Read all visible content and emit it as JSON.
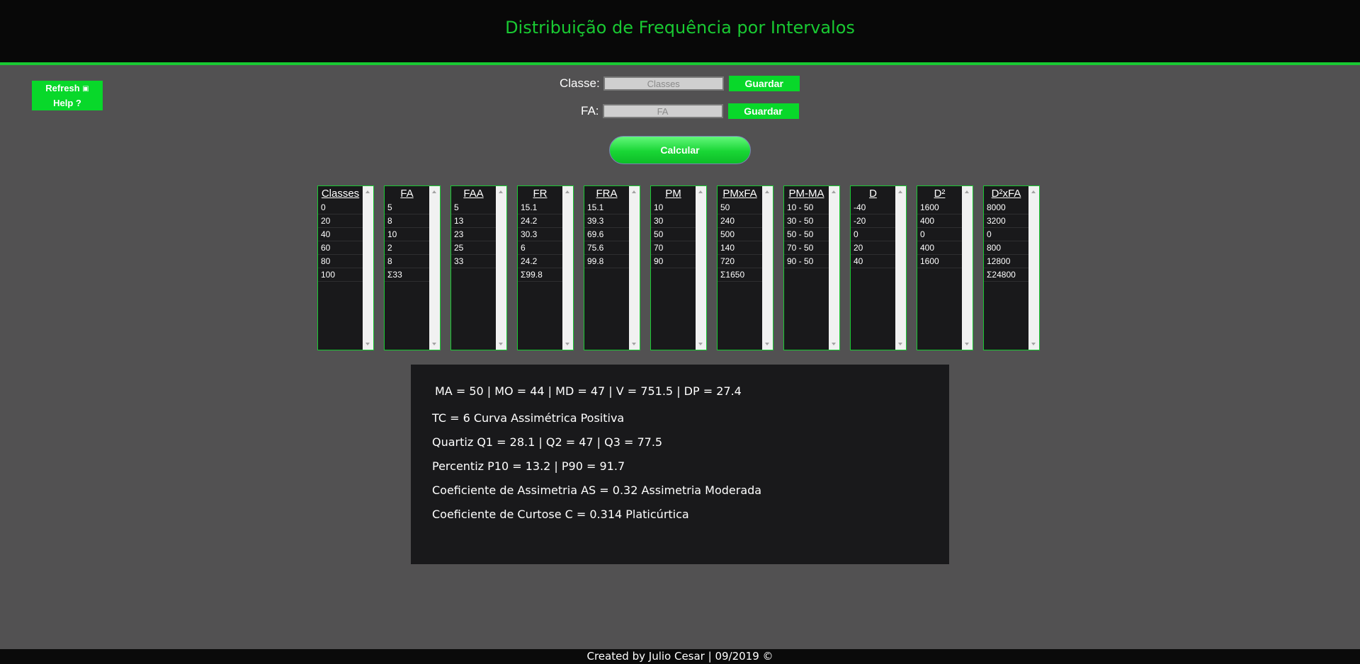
{
  "header": {
    "title": "Distribuição de Frequência por Intervalos"
  },
  "side": {
    "refresh_label": "Refresh",
    "help_label": "Help ?"
  },
  "form": {
    "classe_label": "Classe:",
    "classe_placeholder": "Classes",
    "fa_label": "FA:",
    "fa_placeholder": "FA",
    "save_label": "Guardar",
    "calc_label": "Calcular"
  },
  "columns": [
    {
      "title": "Classes",
      "values": [
        "0",
        "20",
        "40",
        "60",
        "80",
        "100"
      ]
    },
    {
      "title": "FA",
      "values": [
        "5",
        "8",
        "10",
        "2",
        "8",
        "Σ33"
      ]
    },
    {
      "title": "FAA",
      "values": [
        "5",
        "13",
        "23",
        "25",
        "33"
      ]
    },
    {
      "title": "FR",
      "values": [
        "15.1",
        "24.2",
        "30.3",
        "6",
        "24.2",
        "Σ99.8"
      ]
    },
    {
      "title": "FRA",
      "values": [
        "15.1",
        "39.3",
        "69.6",
        "75.6",
        "99.8"
      ]
    },
    {
      "title": "PM",
      "values": [
        "10",
        "30",
        "50",
        "70",
        "90"
      ]
    },
    {
      "title": "PMxFA",
      "values": [
        "50",
        "240",
        "500",
        "140",
        "720",
        "Σ1650"
      ]
    },
    {
      "title": "PM-MA",
      "values": [
        "10 - 50",
        "30 - 50",
        "50 - 50",
        "70 - 50",
        "90 - 50"
      ]
    },
    {
      "title": "D",
      "values": [
        "-40",
        "-20",
        "0",
        "20",
        "40"
      ]
    },
    {
      "title": "D²",
      "values": [
        "1600",
        "400",
        "0",
        "400",
        "1600"
      ]
    },
    {
      "title": "D²xFA",
      "values": [
        "8000",
        "3200",
        "0",
        "800",
        "12800",
        "Σ24800"
      ]
    }
  ],
  "results": {
    "line1": "MA = 50 | MO = 44 | MD = 47 | V = 751.5 | DP = 27.4",
    "line2": "TC = 6 Curva Assimétrica Positiva",
    "line3": "Quartiz Q1 = 28.1 | Q2 = 47 | Q3 = 77.5",
    "line4": "Percentiz P10 = 13.2 | P90 = 91.7",
    "line5": "Coeficiente de Assimetria AS = 0.32 Assimetria Moderada",
    "line6": "Coeficiente de Curtose C = 0.314 Platicúrtica"
  },
  "footer": {
    "text": "Created by Julio Cesar | 09/2019 ©"
  }
}
